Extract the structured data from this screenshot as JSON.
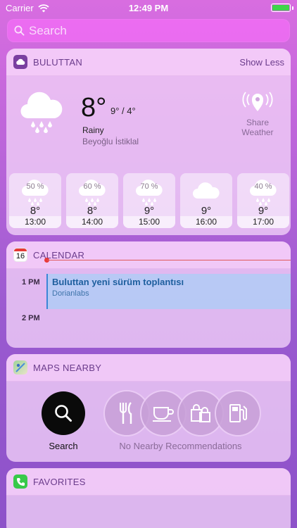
{
  "status_bar": {
    "carrier": "Carrier",
    "time": "12:49 PM",
    "battery_level": 1.0
  },
  "search": {
    "placeholder": "Search"
  },
  "weather": {
    "widget_title": "BULUTTAN",
    "toggle_label": "Show Less",
    "current_temp": "8°",
    "hi_lo": "9° / 4°",
    "condition": "Rainy",
    "location": "Beyoğlu İstiklal",
    "share_label_1": "Share",
    "share_label_2": "Weather",
    "forecast": [
      {
        "pct": "50 %",
        "temp": "8°",
        "time": "13:00",
        "icon": "rain-cloud-icon"
      },
      {
        "pct": "60 %",
        "temp": "8°",
        "time": "14:00",
        "icon": "rain-cloud-icon"
      },
      {
        "pct": "70 %",
        "temp": "9°",
        "time": "15:00",
        "icon": "rain-cloud-icon"
      },
      {
        "pct": "",
        "temp": "9°",
        "time": "16:00",
        "icon": "cloud-icon"
      },
      {
        "pct": "40 %",
        "temp": "9°",
        "time": "17:00",
        "icon": "rain-cloud-icon"
      }
    ]
  },
  "calendar": {
    "widget_title": "CALENDAR",
    "icon_day": "16",
    "hour_1": "1 PM",
    "hour_2": "2 PM",
    "event_title": "Buluttan yeni sürüm toplantısı",
    "event_subtitle": "Dorianlabs"
  },
  "maps": {
    "widget_title": "MAPS NEARBY",
    "search_label": "Search",
    "no_recommendations": "No Nearby Recommendations",
    "categories": [
      "restaurant-icon",
      "coffee-icon",
      "shopping-icon",
      "gas-station-icon"
    ]
  },
  "favorites": {
    "widget_title": "FAVORITES"
  },
  "colors": {
    "accent": "#6b3c8c",
    "event_blue": "#1e5f9e",
    "now_line": "#e05a5a",
    "battery": "#3fd44b"
  }
}
